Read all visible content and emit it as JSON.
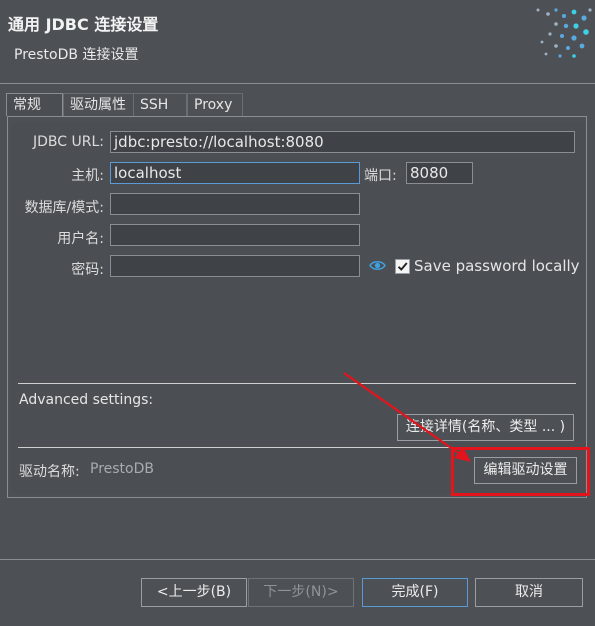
{
  "header": {
    "title": "通用 JDBC 连接设置",
    "subtitle": "PrestoDB 连接设置",
    "logo_icon": "dbeaver-dots-logo"
  },
  "tabs": [
    {
      "label": "常规",
      "active": true
    },
    {
      "label": "驱动属性",
      "active": false
    },
    {
      "label": "SSH",
      "active": false
    },
    {
      "label": "Proxy",
      "active": false
    }
  ],
  "form": {
    "jdbc_url_label": "JDBC URL:",
    "jdbc_url_value": "jdbc:presto://localhost:8080",
    "host_label": "主机:",
    "host_value": "localhost",
    "port_label": "端口:",
    "port_value": "8080",
    "database_label": "数据库/模式:",
    "database_value": "",
    "username_label": "用户名:",
    "username_value": "",
    "password_label": "密码:",
    "password_value": "",
    "show_password_icon": "eye-icon",
    "save_password_label": "Save password locally",
    "save_password_checked": true
  },
  "advanced": {
    "label": "Advanced settings:",
    "details_button": "连接详情(名称、类型 ... )"
  },
  "driver": {
    "label": "驱动名称:",
    "value": "PrestoDB",
    "edit_button": "编辑驱动设置"
  },
  "footer": {
    "back": "<上一步(B)",
    "next": "下一步(N)>",
    "finish": "完成(F)",
    "cancel": "取消"
  },
  "annotation": {
    "color": "#e3141c"
  }
}
